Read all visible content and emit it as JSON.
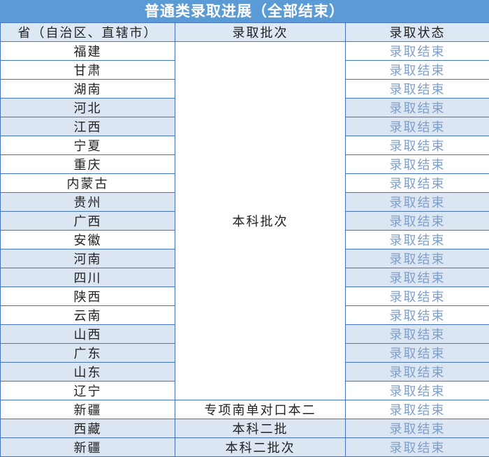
{
  "title": "普通类录取进展（全部结束）",
  "headers": {
    "province": "省（自治区、直辖市）",
    "batch": "录取批次",
    "status": "录取状态"
  },
  "merged_batch_label": "本科批次",
  "rows": [
    {
      "province": "福建",
      "status": "录取结束",
      "shaded": false
    },
    {
      "province": "甘肃",
      "status": "录取结束",
      "shaded": false
    },
    {
      "province": "湖南",
      "status": "录取结束",
      "shaded": false
    },
    {
      "province": "河北",
      "status": "录取结束",
      "shaded": true
    },
    {
      "province": "江西",
      "status": "录取结束",
      "shaded": true
    },
    {
      "province": "宁夏",
      "status": "录取结束",
      "shaded": false
    },
    {
      "province": "重庆",
      "status": "录取结束",
      "shaded": false
    },
    {
      "province": "内蒙古",
      "status": "录取结束",
      "shaded": false
    },
    {
      "province": "贵州",
      "status": "录取结束",
      "shaded": true
    },
    {
      "province": "广西",
      "status": "录取结束",
      "shaded": true
    },
    {
      "province": "安徽",
      "status": "录取结束",
      "shaded": false
    },
    {
      "province": "河南",
      "status": "录取结束",
      "shaded": true
    },
    {
      "province": "四川",
      "status": "录取结束",
      "shaded": true
    },
    {
      "province": "陕西",
      "status": "录取结束",
      "shaded": false
    },
    {
      "province": "云南",
      "status": "录取结束",
      "shaded": false
    },
    {
      "province": "山西",
      "status": "录取结束",
      "shaded": true
    },
    {
      "province": "广东",
      "status": "录取结束",
      "shaded": true
    },
    {
      "province": "山东",
      "status": "录取结束",
      "shaded": true
    },
    {
      "province": "辽宁",
      "status": "录取结束",
      "shaded": false
    },
    {
      "province": "新疆",
      "batch": "专项南单对口本二",
      "status": "录取结束",
      "shaded": false
    },
    {
      "province": "西藏",
      "batch": "本科二批",
      "status": "录取结束",
      "shaded": true
    },
    {
      "province": "新疆",
      "batch": "本科二批次",
      "status": "录取结束",
      "shaded": true
    }
  ],
  "colors": {
    "title_bg": "#5b9bd5",
    "header_bg": "#dde8f5",
    "shade_bg": "#dce6f2",
    "border": "#4472c4",
    "status_text": "#7f9fc8"
  }
}
